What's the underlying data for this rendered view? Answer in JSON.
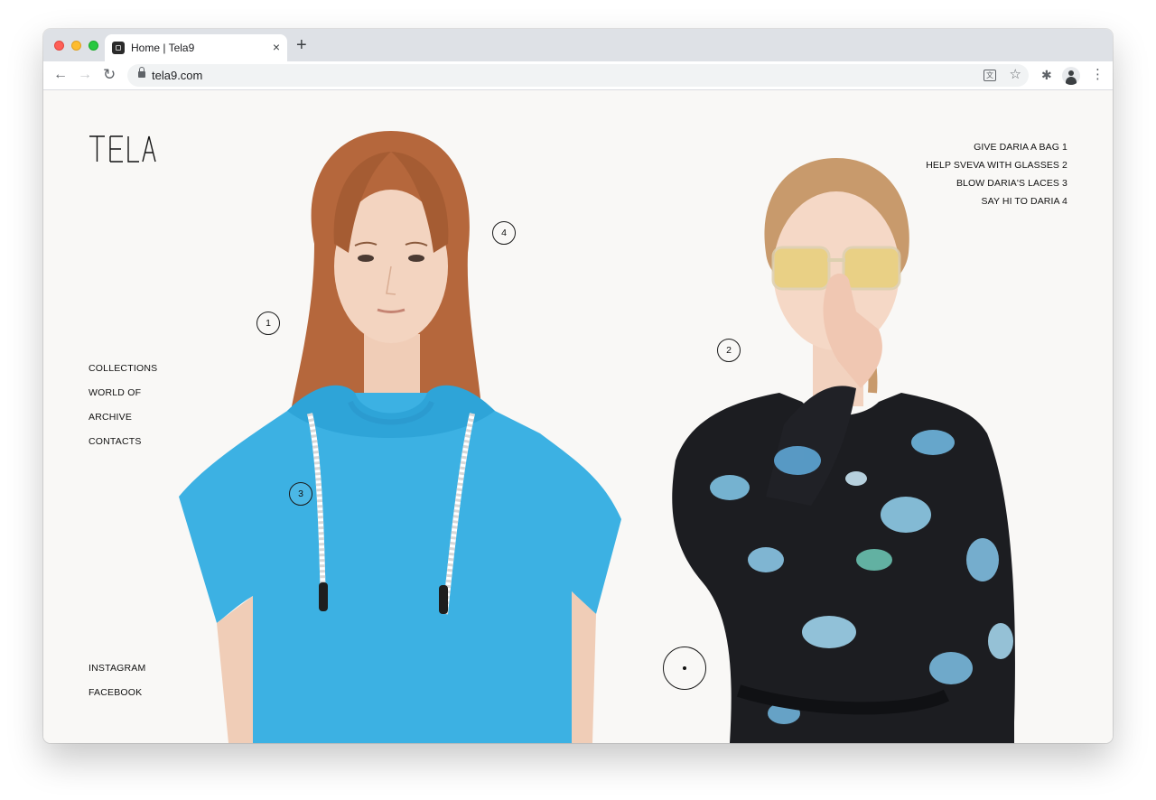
{
  "browser": {
    "tab_title": "Home | Tela9",
    "close_glyph": "×",
    "new_tab_glyph": "+",
    "url": "tela9.com",
    "icons": [
      "back-icon",
      "forward-icon",
      "reload-icon",
      "lock-icon",
      "translate-icon",
      "star-icon",
      "extensions-icon",
      "avatar",
      "menu-icon"
    ]
  },
  "site": {
    "logo_text": "TELA",
    "nav": [
      "COLLECTIONS",
      "WORLD OF",
      "ARCHIVE",
      "CONTACTS"
    ],
    "social": [
      "INSTAGRAM",
      "FACEBOOK"
    ],
    "hotspots": [
      "GIVE DARIA A BAG 1",
      "HELP SVEVA WITH GLASSES 2",
      "BLOW DARIA'S LACES 3",
      "SAY HI TO DARIA 4"
    ],
    "markers": [
      "1",
      "2",
      "3",
      "4"
    ]
  },
  "colors": {
    "page_bg": "#f9f8f6",
    "hoodie": "#3cb1e3",
    "dress": "#1c1d21",
    "hair": "#b5673c",
    "text": "#111111"
  }
}
